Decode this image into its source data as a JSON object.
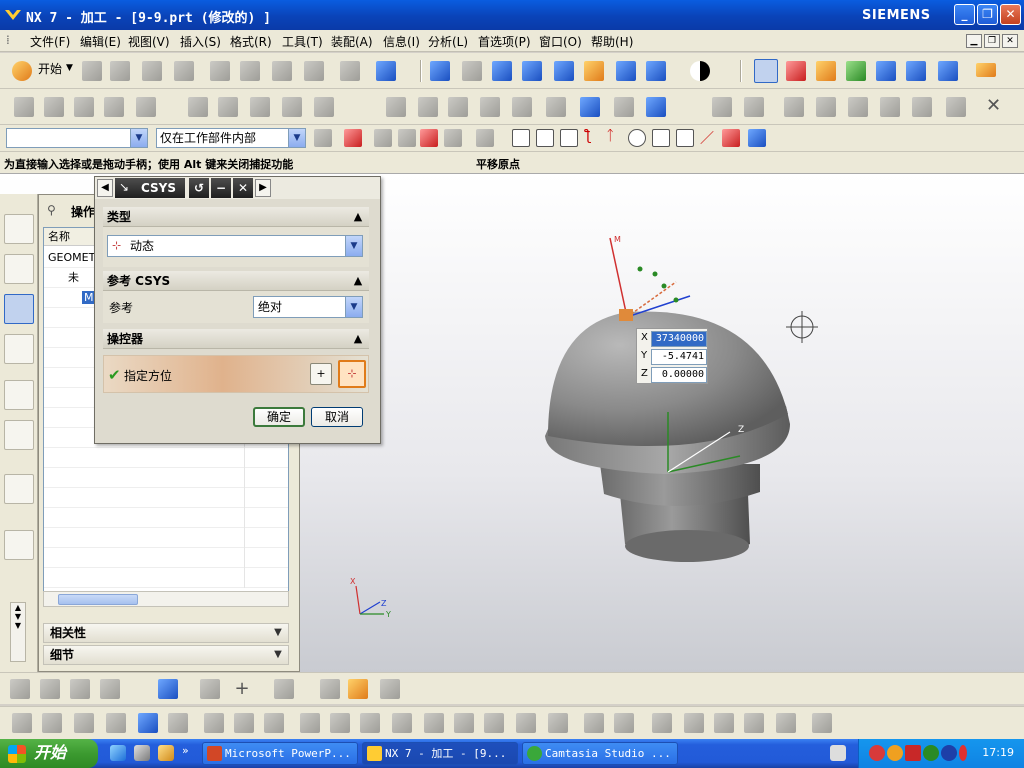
{
  "window": {
    "title": "NX 7 - 加工 - [9-9.prt  (修改的) ]",
    "brand": "SIEMENS",
    "minimize": "_",
    "maximize": "❐",
    "close": "✕"
  },
  "menu": {
    "items": [
      "文件(F)",
      "编辑(E)",
      "视图(V)",
      "插入(S)",
      "格式(R)",
      "工具(T)",
      "装配(A)",
      "信息(I)",
      "分析(L)",
      "首选项(P)",
      "窗口(O)",
      "帮助(H)"
    ]
  },
  "toolbar": {
    "start_label": "开始",
    "filter_value": "",
    "scope_value": "仅在工作部件内部"
  },
  "cue": {
    "prompt": "为直接输入选择或是拖动手柄；使用 Alt 键来关闭捕捉功能",
    "status": "平移原点"
  },
  "navigator": {
    "title": "操作",
    "header_name": "名称",
    "rows": [
      "GEOMET",
      "未",
      "M"
    ],
    "related": "相关性",
    "details": "细节"
  },
  "dialog": {
    "title": "CSYS",
    "type_group": "类型",
    "type_value": "动态",
    "ref_group": "参考 CSYS",
    "ref_label": "参考",
    "ref_value": "绝对",
    "manip_group": "操控器",
    "specify_orientation": "指定方位",
    "ok": "确定",
    "cancel": "取消"
  },
  "coords": {
    "x_label": "X",
    "x_value": "37340000",
    "y_label": "Y",
    "y_value": "-5.4741",
    "z_label": "Z",
    "z_value": "0.00000"
  },
  "taskbar": {
    "start": "开始",
    "tasks": [
      "Microsoft PowerP...",
      "NX 7 - 加工 - [9...",
      "Camtasia Studio ..."
    ],
    "clock": "17:19"
  }
}
